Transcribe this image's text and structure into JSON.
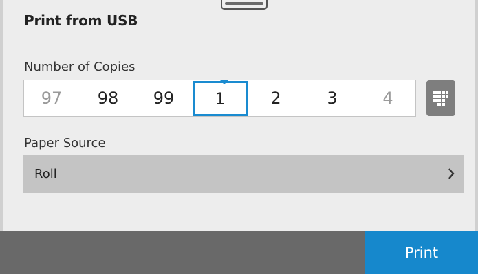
{
  "header": {
    "title": "Print from USB"
  },
  "copies": {
    "label": "Number of Copies",
    "values": [
      "97",
      "98",
      "99",
      "1",
      "2",
      "3",
      "4"
    ],
    "selected": "1",
    "keypad_icon": "keypad-icon"
  },
  "paper_source": {
    "label": "Paper Source",
    "value": "Roll",
    "chevron_icon": "chevron-right-icon"
  },
  "footer": {
    "print_label": "Print"
  },
  "colors": {
    "accent": "#1688cc",
    "footer_bar": "#696969",
    "row_background": "#c4c4c4"
  }
}
